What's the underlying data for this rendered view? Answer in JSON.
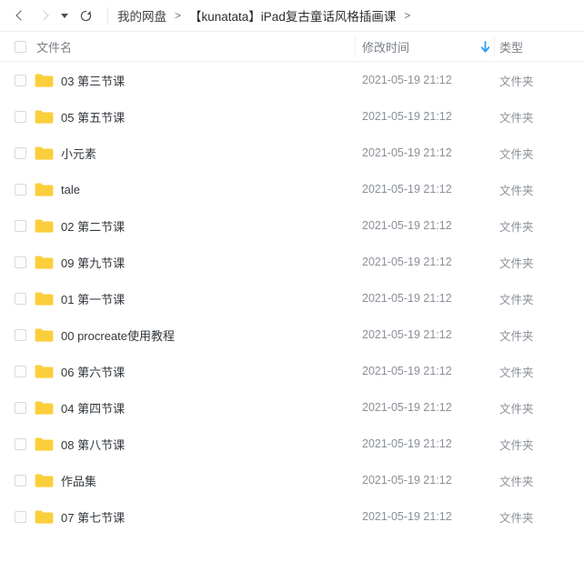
{
  "toolbar": {
    "back_icon": "chevron-left-icon",
    "forward_icon": "chevron-right-icon",
    "dropdown_icon": "caret-down-icon",
    "refresh_icon": "refresh-icon",
    "breadcrumb": {
      "root": "我的网盘",
      "separator": ">",
      "current": "【kunatata】iPad复古童话风格插画课",
      "trailing_separator": ">"
    }
  },
  "table": {
    "columns": {
      "name": "文件名",
      "time": "修改时间",
      "type": "类型"
    },
    "sort": {
      "column": "修改时间",
      "direction": "descending",
      "icon": "arrow-down-icon",
      "color": "#2b9bf4"
    },
    "select_all_checked": false,
    "rows": [
      {
        "name": "03 第三节课",
        "time": "2021-05-19 21:12",
        "type": "文件夹",
        "checked": false
      },
      {
        "name": "05 第五节课",
        "time": "2021-05-19 21:12",
        "type": "文件夹",
        "checked": false
      },
      {
        "name": "小元素",
        "time": "2021-05-19 21:12",
        "type": "文件夹",
        "checked": false
      },
      {
        "name": "tale",
        "time": "2021-05-19 21:12",
        "type": "文件夹",
        "checked": false
      },
      {
        "name": "02 第二节课",
        "time": "2021-05-19 21:12",
        "type": "文件夹",
        "checked": false
      },
      {
        "name": "09 第九节课",
        "time": "2021-05-19 21:12",
        "type": "文件夹",
        "checked": false
      },
      {
        "name": "01 第一节课",
        "time": "2021-05-19 21:12",
        "type": "文件夹",
        "checked": false
      },
      {
        "name": "00 procreate使用教程",
        "time": "2021-05-19 21:12",
        "type": "文件夹",
        "checked": false
      },
      {
        "name": "06 第六节课",
        "time": "2021-05-19 21:12",
        "type": "文件夹",
        "checked": false
      },
      {
        "name": "04 第四节课",
        "time": "2021-05-19 21:12",
        "type": "文件夹",
        "checked": false
      },
      {
        "name": "08 第八节课",
        "time": "2021-05-19 21:12",
        "type": "文件夹",
        "checked": false
      },
      {
        "name": "作品集",
        "time": "2021-05-19 21:12",
        "type": "文件夹",
        "checked": false
      },
      {
        "name": "07 第七节课",
        "time": "2021-05-19 21:12",
        "type": "文件夹",
        "checked": false
      }
    ],
    "folder_icon": "folder-icon",
    "folder_color": "#fbce3c"
  }
}
